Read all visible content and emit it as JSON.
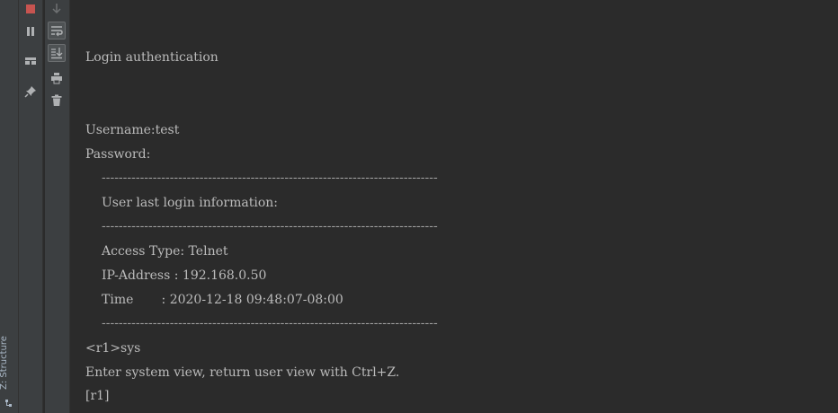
{
  "sidebar": {
    "structure_tab_label": "Z: Structure"
  },
  "toolbar": {
    "col1": [
      "stop-icon",
      "pause-icon",
      "layout-icon",
      "pin-icon"
    ],
    "col2": [
      "down-arrow-icon",
      "soft-wrap-icon",
      "scroll-to-end-icon",
      "print-icon",
      "trash-icon"
    ]
  },
  "console": {
    "lines": {
      "login_auth": "Login authentication",
      "username": "Username:test",
      "password": "Password:",
      "sep1": "-------------------------------------------------------------------------------",
      "last_login_info": "User last login information:",
      "sep2": "-------------------------------------------------------------------------------",
      "access_type": "Access Type: Telnet",
      "ip_address": "IP-Address : 192.168.0.50",
      "time": "Time       : 2020-12-18 09:48:07-08:00",
      "sep3": "-------------------------------------------------------------------------------",
      "prompt_cmd": "<r1>sys",
      "enter_system_view": "Enter system view, return user view with Ctrl+Z.",
      "prompt_system": "[r1]"
    }
  },
  "colors": {
    "background": "#2b2b2b",
    "text": "#bbbbbb",
    "stop": "#c75450",
    "toolbar": "#3c3f41"
  }
}
